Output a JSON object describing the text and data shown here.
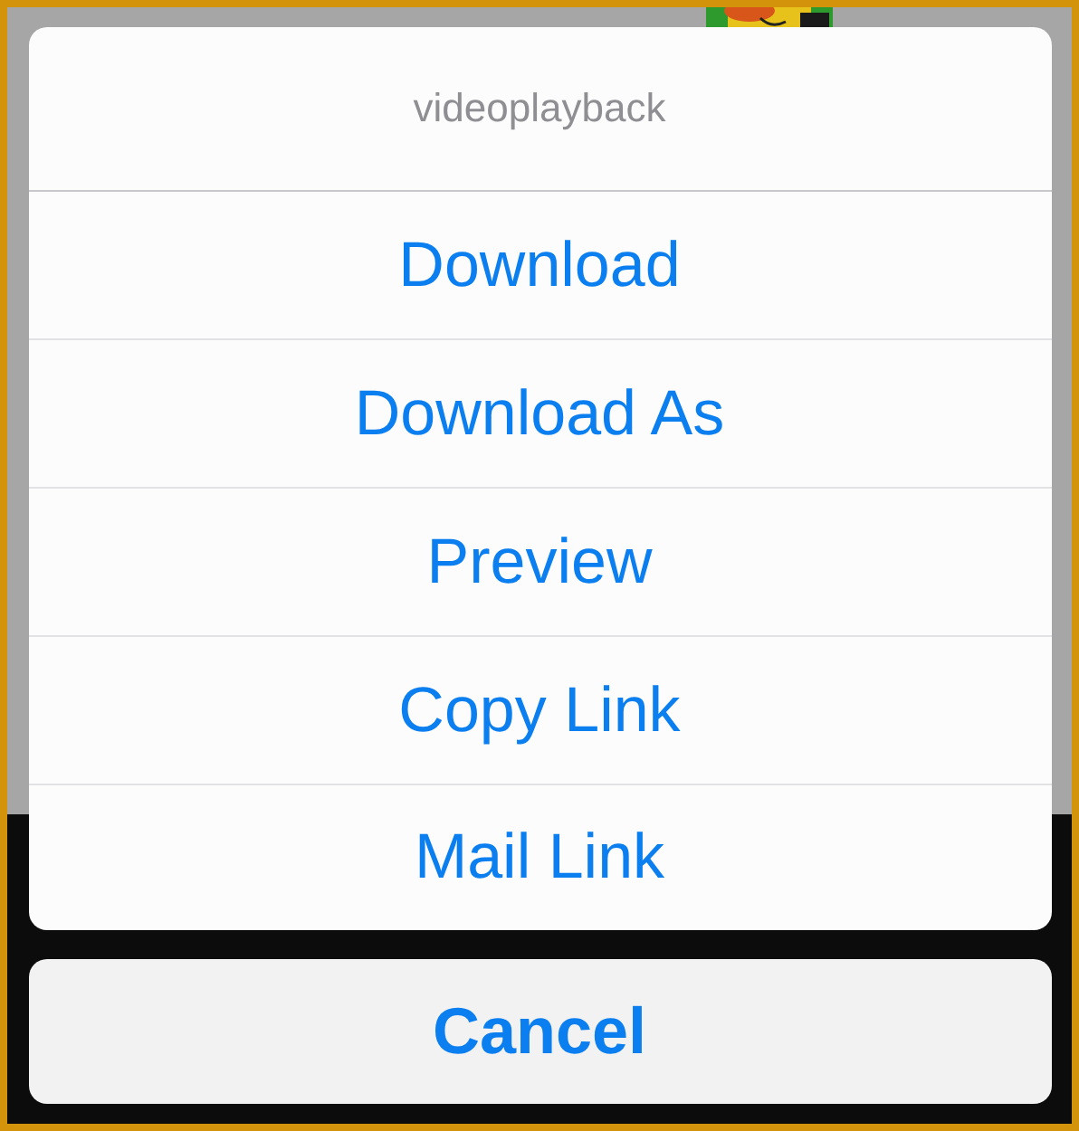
{
  "action_sheet": {
    "title": "videoplayback",
    "actions": [
      {
        "label": "Download"
      },
      {
        "label": "Download As"
      },
      {
        "label": "Preview"
      },
      {
        "label": "Copy Link"
      },
      {
        "label": "Mail Link"
      }
    ]
  },
  "cancel_button": {
    "label": "Cancel"
  }
}
